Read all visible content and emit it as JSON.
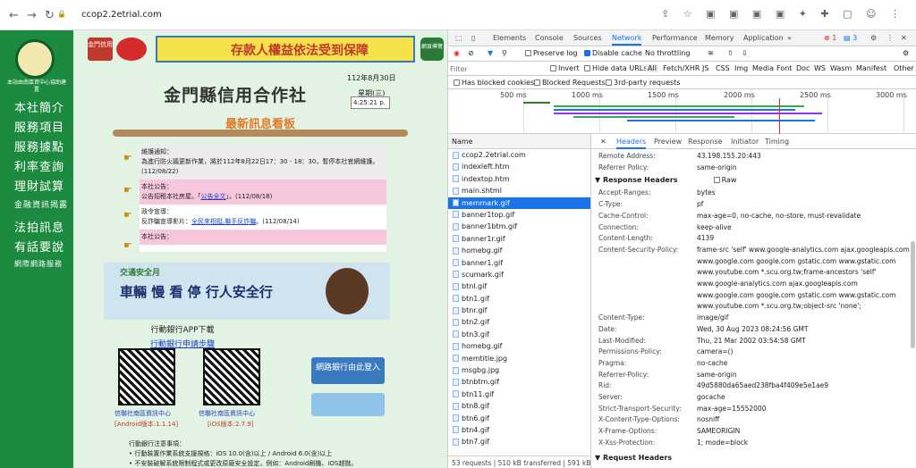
{
  "browser": {
    "url": "ccop2.2etrial.com",
    "nav_back": "←",
    "nav_forward": "→",
    "reload": "↻",
    "lock": "🔒",
    "icons": "⇪ ☆ ▣ ▣ ▣ ▣ ✦ ✚ ▢ ☺ ⋮"
  },
  "site": {
    "logo_text": "本站由南區資中心協助建置",
    "nav": [
      "本社簡介",
      "服務項目",
      "服務據點",
      "利率查詢",
      "理財試算",
      "金融資訊揭露",
      "法拍訊息",
      "有話要說",
      "網際網路服務"
    ],
    "banner_left": "金門信用",
    "banner_text": "存款人權益依法受到保障",
    "banner_badge": "網頁導覽",
    "title": "金門縣信用合作社",
    "date": "112年8月30日",
    "weekday": "星期(三)",
    "clock": "4:25:21 p.",
    "notice_title": "最新訊息看板",
    "notices": [
      {
        "head": "維護通知：",
        "body": "為進行防火牆更新作業，將於112年8月22日17：30 - 18：30，暫停本社官網維護。(112/08/22)",
        "link": "",
        "tail": "",
        "style": "grey"
      },
      {
        "head": "本社公告：",
        "body": "公告招租本社房屋。「",
        "link": "公告全文",
        "tail": "」。(112/08/18)",
        "style": "pink"
      },
      {
        "head": "政令宣導：",
        "body": "反詐騙宣導影片：",
        "link": "全民來相挺,聯手反詐騙",
        "tail": "。(112/08/14)",
        "style": "white"
      },
      {
        "head": "本社公告：",
        "body": "",
        "link": "",
        "tail": "",
        "style": "pink"
      }
    ],
    "promo_brand": "交通安全月",
    "promo_text": "車輛 慢 看 停 行人安全行",
    "app_title": "行動銀行APP下載",
    "app_link": "行動銀行申請步驟",
    "qr1_label": "信聯社南區資訊中心",
    "qr1_ver": "[Android版本:1.1.14]",
    "qr2_label": "信聯社南區資訊中心",
    "qr2_ver": "[iOS版本:2.7.9]",
    "netbank": "網路銀行由此登入",
    "tips_title": "行動銀行注意事項：",
    "tip1": "行動裝置作業系統支援規格：iOS 10.0(含)以上 / Android 6.0(含)以上",
    "tip2": "不安裝破解系統限制程式或更改原廠安全設定，例如：Android刷機、iOS越獄。"
  },
  "devtools": {
    "tabs": [
      "Elements",
      "Console",
      "Sources",
      "Network",
      "Performance",
      "Memory",
      "Application",
      "»"
    ],
    "active_tab": "Network",
    "errors": "1",
    "warnings": "3",
    "preserve_log": "Preserve log",
    "disable_cache": "Disable cache",
    "throttle": "No throttling",
    "filter_placeholder": "Filter",
    "invert": "Invert",
    "hide_data": "Hide data URLs",
    "types": [
      "All",
      "Fetch/XHR",
      "JS",
      "CSS",
      "Img",
      "Media",
      "Font",
      "Doc",
      "WS",
      "Wasm",
      "Manifest",
      "Other"
    ],
    "blocked_cookies": "Has blocked cookies",
    "blocked_requests": "Blocked Requests",
    "third_party": "3rd-party requests",
    "ticks": [
      "500 ms",
      "1000 ms",
      "1500 ms",
      "2000 ms",
      "2500 ms",
      "3000 ms"
    ],
    "list_header": "Name",
    "requests": [
      "ccop2.2etrial.com",
      "indexleft.htm",
      "indextop.htm",
      "main.shtml",
      "memmark.gif",
      "banner1top.gif",
      "banner1btm.gif",
      "banner1r.gif",
      "homebg.gif",
      "banner1.gif",
      "scumark.gif",
      "btnl.gif",
      "btn1.gif",
      "btnr.gif",
      "btn2.gif",
      "btn3.gif",
      "homebg.gif",
      "memtitle.jpg",
      "msgbg.jpg",
      "btnbtm.gif",
      "btn11.gif",
      "btn8.gif",
      "btn6.gif",
      "btn4.gif",
      "btn7.gif"
    ],
    "selected": "memmark.gif",
    "footer": "53 requests  |  510 kB transferred  |  591 kB",
    "detail_tabs": [
      "Headers",
      "Preview",
      "Response",
      "Initiator",
      "Timing"
    ],
    "active_detail": "Headers",
    "close": "✕",
    "general": [
      {
        "k": "Remote Address:",
        "v": "43.198.155.20:443"
      },
      {
        "k": "Referrer Policy:",
        "v": "same-origin"
      }
    ],
    "response_title": "▼ Response Headers",
    "raw": "Raw",
    "response": [
      {
        "k": "Accept-Ranges:",
        "v": "bytes"
      },
      {
        "k": "C-Type:",
        "v": "pf"
      },
      {
        "k": "Cache-Control:",
        "v": "max-age=0, no-cache, no-store, must-revalidate"
      },
      {
        "k": "Connection:",
        "v": "keep-alive"
      },
      {
        "k": "Content-Length:",
        "v": "4139"
      },
      {
        "k": "Content-Security-Policy:",
        "v": "frame-src 'self' www.google-analytics.com ajax.googleapis.com"
      },
      {
        "k": "",
        "v": "www.google.com google.com gstatic.com www.gstatic.com"
      },
      {
        "k": "",
        "v": "www.youtube.com *.scu.org.tw;frame-ancestors 'self'"
      },
      {
        "k": "",
        "v": "www.google-analytics.com ajax.googleapis.com"
      },
      {
        "k": "",
        "v": "www.google.com google.com gstatic.com www.gstatic.com"
      },
      {
        "k": "",
        "v": "www.youtube.com *.scu.org.tw;object-src 'none';"
      },
      {
        "k": "Content-Type:",
        "v": "image/gif"
      },
      {
        "k": "Date:",
        "v": "Wed, 30 Aug 2023 08:24:56 GMT"
      },
      {
        "k": "Last-Modified:",
        "v": "Thu, 21 Mar 2002 03:54:58 GMT"
      },
      {
        "k": "Permissions-Policy:",
        "v": "camera=()"
      },
      {
        "k": "Pragma:",
        "v": "no-cache"
      },
      {
        "k": "Referrer-Policy:",
        "v": "same-origin"
      },
      {
        "k": "Rid:",
        "v": "49d5880da65aed238fba4f409e5e1ae9"
      },
      {
        "k": "Server:",
        "v": "gocache"
      },
      {
        "k": "Strict-Transport-Security:",
        "v": "max-age=15552000"
      },
      {
        "k": "X-Content-Type-Options:",
        "v": "nosniff"
      },
      {
        "k": "X-Frame-Options:",
        "v": "SAMEORIGIN"
      },
      {
        "k": "X-Xss-Protection:",
        "v": "1; mode=block"
      }
    ],
    "request_title": "▼ Request Headers"
  }
}
